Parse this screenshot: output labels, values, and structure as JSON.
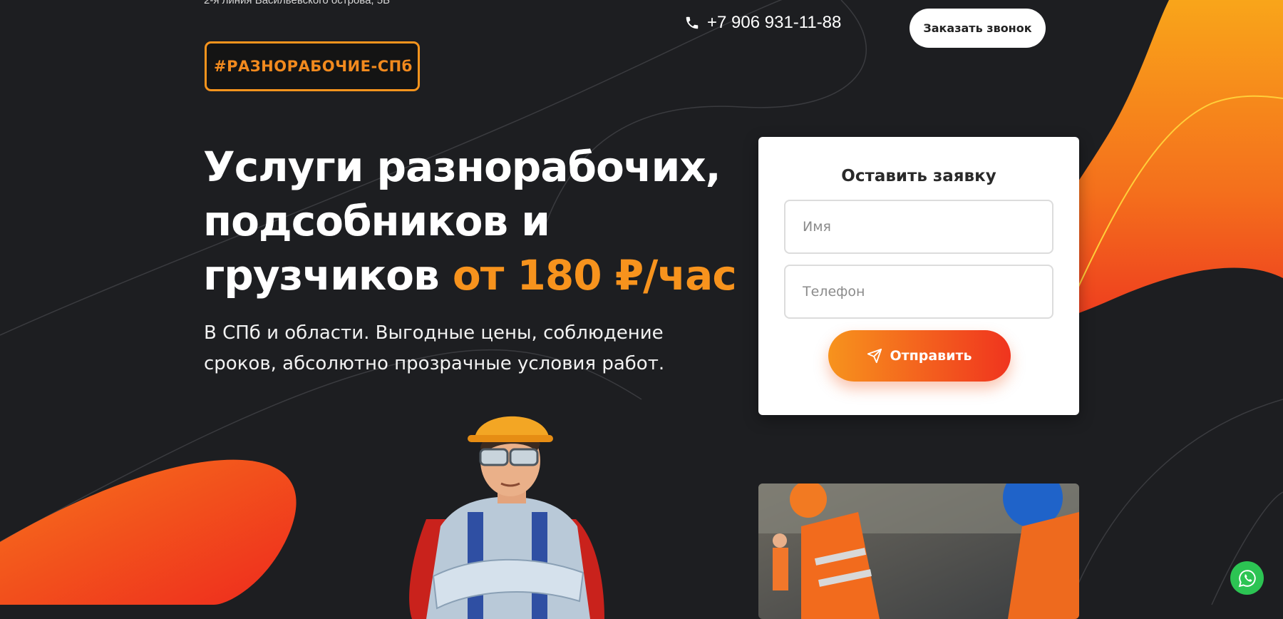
{
  "header": {
    "address": "2-я линия Васильевского острова, 5Б",
    "logo_text": "#РАЗНОРАБОЧИЕ-СПб",
    "phone": "+7 906 931-11-88",
    "callback_button": "Заказать звонок"
  },
  "hero": {
    "title_main": "Услуги разнорабочих, подсобников и грузчиков",
    "title_accent": "от 180 ₽/час",
    "subtitle": "В СПб и области. Выгодные цены, соблюдение сроков, абсолютно прозрачные условия работ."
  },
  "form": {
    "title": "Оставить заявку",
    "name_placeholder": "Имя",
    "phone_placeholder": "Телефон",
    "submit_label": "Отправить"
  },
  "colors": {
    "accent_orange": "#f7931d",
    "accent_red": "#f0341e",
    "background": "#1d1e21",
    "whatsapp": "#2cc453"
  },
  "icons": [
    "phone-icon",
    "paper-plane-icon",
    "whatsapp-icon"
  ]
}
